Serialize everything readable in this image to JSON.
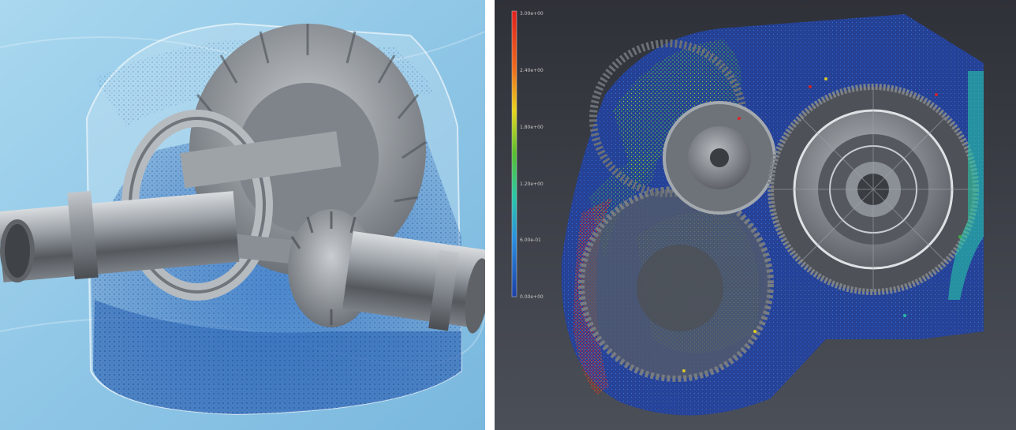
{
  "left_image": {
    "subject": "gear-differential-oil-simulation",
    "colors": {
      "background": "#9fd0ea",
      "particles": "#2a63b3",
      "metal": "#a8adb2"
    }
  },
  "right_image": {
    "subject": "gearbox-particle-velocity-simulation",
    "title": "",
    "colors": {
      "background": "#3b3e45",
      "metal": "#8c9096"
    },
    "legend": {
      "ticks": [
        "3.00e+00",
        "2.40e+00",
        "1.80e+00",
        "1.20e+00",
        "6.00e-01",
        "0.00e+00"
      ]
    }
  }
}
